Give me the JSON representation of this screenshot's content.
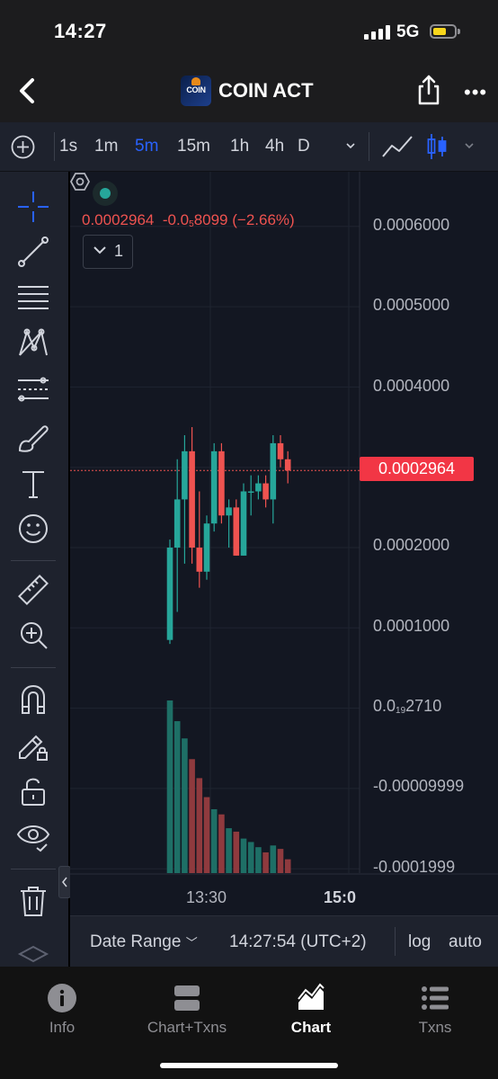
{
  "status_bar": {
    "time": "14:27",
    "network": "5G"
  },
  "header": {
    "title": "COIN ACT",
    "logo_text": "COIN"
  },
  "toolbar": {
    "intervals": [
      {
        "label": "1s",
        "active": false
      },
      {
        "label": "1m",
        "active": false
      },
      {
        "label": "5m",
        "active": true
      },
      {
        "label": "15m",
        "active": false
      },
      {
        "label": "1h",
        "active": false
      },
      {
        "label": "4h",
        "active": false
      },
      {
        "label": "D",
        "active": false
      }
    ]
  },
  "legend": {
    "price": "0.0002964",
    "change_prefix": "-0.0",
    "change_sub": "5",
    "change_suffix": "8099",
    "change_pct": "(−2.66%)",
    "collapse_count": "1"
  },
  "price_axis": {
    "labels": [
      "0.0006000",
      "0.0005000",
      "0.0004000",
      "0.0002000",
      "0.0001000",
      "-0.00009999",
      "-0.0001999"
    ],
    "zero_label": {
      "prefix": "0.0",
      "sub": "19",
      "suffix": "2710"
    },
    "current_price": "0.0002964"
  },
  "time_axis": {
    "labels": [
      "13:30",
      "15:0"
    ]
  },
  "range_bar": {
    "date_range": "Date Range",
    "time": "14:27:54 (UTC+2)",
    "log": "log",
    "auto": "auto"
  },
  "tabs": [
    {
      "label": "Info",
      "icon": "info-icon",
      "active": false
    },
    {
      "label": "Chart+Txns",
      "icon": "split-view-icon",
      "active": false
    },
    {
      "label": "Chart",
      "icon": "area-chart-icon",
      "active": true
    },
    {
      "label": "Txns",
      "icon": "list-icon",
      "active": false
    }
  ],
  "colors": {
    "up": "#26a69a",
    "down": "#ef5350",
    "accent": "#2962ff",
    "price_tag": "#f23645"
  },
  "chart_data": {
    "type": "candlestick",
    "interval": "5m",
    "y_unit": "price",
    "ylim": [
      -0.0002,
      0.00066
    ],
    "candles": [
      {
        "o": 8.5e-05,
        "h": 0.00021,
        "l": 8e-05,
        "c": 0.0002
      },
      {
        "o": 0.0002,
        "h": 0.00031,
        "l": 0.00012,
        "c": 0.00026
      },
      {
        "o": 0.00026,
        "h": 0.00034,
        "l": 0.00018,
        "c": 0.00032
      },
      {
        "o": 0.00032,
        "h": 0.00035,
        "l": 0.00018,
        "c": 0.0002
      },
      {
        "o": 0.0002,
        "h": 0.00027,
        "l": 0.00015,
        "c": 0.00017
      },
      {
        "o": 0.00017,
        "h": 0.00024,
        "l": 0.00016,
        "c": 0.00023
      },
      {
        "o": 0.00023,
        "h": 0.00033,
        "l": 0.00022,
        "c": 0.00032
      },
      {
        "o": 0.00032,
        "h": 0.00033,
        "l": 0.00023,
        "c": 0.00024
      },
      {
        "o": 0.00024,
        "h": 0.00026,
        "l": 0.0002,
        "c": 0.00025
      },
      {
        "o": 0.00025,
        "h": 0.00026,
        "l": 0.00019,
        "c": 0.00019
      },
      {
        "o": 0.00019,
        "h": 0.00028,
        "l": 0.00019,
        "c": 0.00027
      },
      {
        "o": 0.00027,
        "h": 0.00029,
        "l": 0.00024,
        "c": 0.00027
      },
      {
        "o": 0.00027,
        "h": 0.00029,
        "l": 0.00026,
        "c": 0.00028
      },
      {
        "o": 0.00028,
        "h": 0.00029,
        "l": 0.00025,
        "c": 0.00026
      },
      {
        "o": 0.00026,
        "h": 0.00034,
        "l": 0.00023,
        "c": 0.00033
      },
      {
        "o": 0.00033,
        "h": 0.00034,
        "l": 0.0003,
        "c": 0.00031
      },
      {
        "o": 0.00031,
        "h": 0.00032,
        "l": 0.00028,
        "c": 0.000296
      }
    ],
    "volume": [
      {
        "v": 100,
        "up": true
      },
      {
        "v": 88,
        "up": true
      },
      {
        "v": 78,
        "up": true
      },
      {
        "v": 66,
        "up": false
      },
      {
        "v": 55,
        "up": false
      },
      {
        "v": 44,
        "up": false
      },
      {
        "v": 37,
        "up": true
      },
      {
        "v": 34,
        "up": false
      },
      {
        "v": 26,
        "up": true
      },
      {
        "v": 24,
        "up": false
      },
      {
        "v": 20,
        "up": true
      },
      {
        "v": 18,
        "up": true
      },
      {
        "v": 15,
        "up": true
      },
      {
        "v": 12,
        "up": false
      },
      {
        "v": 16,
        "up": true
      },
      {
        "v": 14,
        "up": false
      },
      {
        "v": 8,
        "up": false
      }
    ],
    "volume_unit": "relative (max = 100)"
  }
}
